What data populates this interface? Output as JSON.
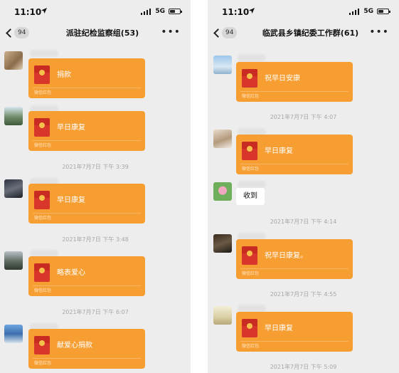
{
  "left_phone": {
    "status": {
      "time": "11:10",
      "network": "5G"
    },
    "nav": {
      "unread": "94",
      "title": "派驻纪检监察组(53)"
    },
    "timestamps": {
      "t1": "2021年7月7日 下午 3:39",
      "t2": "2021年7月7日 下午 3:48",
      "t3": "2021年7月7日 下午 6:07"
    },
    "messages": [
      {
        "title": "捐款",
        "footer": "微信红包"
      },
      {
        "title": "早日康复",
        "footer": "微信红包"
      },
      {
        "title": "早日康复",
        "footer": "微信红包"
      },
      {
        "title": "略表爱心",
        "footer": "微信红包"
      },
      {
        "title": "献爱心捐款",
        "footer": "微信红包"
      }
    ]
  },
  "right_phone": {
    "status": {
      "time": "11:10",
      "network": "5G"
    },
    "nav": {
      "unread": "94",
      "title": "临武县乡镇纪委工作群(61)"
    },
    "timestamps": {
      "t1": "2021年7月7日 下午 4:07",
      "t2": "2021年7月7日 下午 4:14",
      "t3": "2021年7月7日 下午 4:55",
      "t4": "2021年7月7日 下午 5:09"
    },
    "messages": [
      {
        "title": "祝早日安康",
        "footer": "微信红包"
      },
      {
        "title": "早日康复",
        "footer": "微信红包"
      },
      {
        "text": "收到"
      },
      {
        "title": "祝早日康复。",
        "footer": "微信红包"
      },
      {
        "title": "早日康复",
        "footer": "微信红包"
      }
    ]
  },
  "colors": {
    "redpacket": "#f79e33",
    "chat_background": "#ededed",
    "timestamp_text": "#a7a7a7"
  }
}
